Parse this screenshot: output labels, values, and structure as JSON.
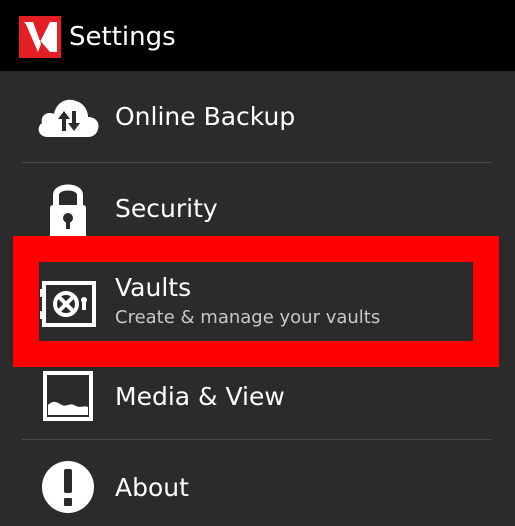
{
  "action_bar": {
    "title": "Settings",
    "logo_icon": "app-logo-icon",
    "logo_color": "#e31e24"
  },
  "settings": {
    "items": [
      {
        "label": "Online Backup",
        "icon": "cloud-sync-icon"
      },
      {
        "label": "Security",
        "icon": "lock-icon"
      },
      {
        "label": "Vaults",
        "subtitle": "Create & manage your vaults",
        "icon": "vault-icon",
        "highlighted": true
      },
      {
        "label": "Media & View",
        "icon": "image-icon"
      },
      {
        "label": "About",
        "icon": "info-icon"
      }
    ]
  },
  "colors": {
    "highlight": "#ff0000",
    "background": "#2b2b2b",
    "action_bar": "#000000"
  }
}
